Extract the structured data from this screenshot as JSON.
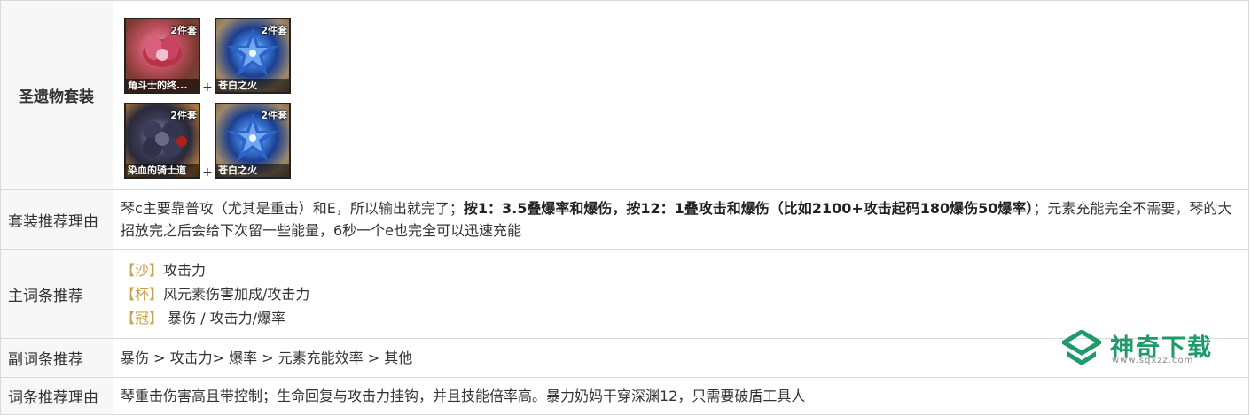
{
  "rows": {
    "set": {
      "label": "圣遗物套装",
      "combos": [
        {
          "items": [
            {
              "badge": "2件套",
              "name": "角斗士的终...",
              "icon": "crimson-flower-icon"
            },
            {
              "badge": "2件套",
              "name": "苍白之火",
              "icon": "blue-flower-icon"
            }
          ],
          "plus": "+"
        },
        {
          "items": [
            {
              "badge": "2件套",
              "name": "染血的骑士道",
              "icon": "dark-flower-icon"
            },
            {
              "badge": "2件套",
              "name": "苍白之火",
              "icon": "blue-flower-icon"
            }
          ],
          "plus": "+"
        }
      ]
    },
    "set_reason": {
      "label": "套装推荐理由",
      "text_a": "琴c主要靠普攻（尤其是重击）和E，所以输出就完了；",
      "text_b": "按1：3.5叠爆率和爆伤，按12：1叠攻击和爆伤（比如2100+攻击起码180爆伤50爆率）",
      "text_c": "；元素充能完全不需要，琴的大招放完之后会给下次留一些能量，6秒一个e也完全可以迅速充能"
    },
    "main_stats": {
      "label": "主词条推荐",
      "slots": [
        {
          "tag": "【沙】",
          "value": "攻击力"
        },
        {
          "tag": "【杯】",
          "value": "风元素伤害加成/攻击力"
        },
        {
          "tag": "【冠】",
          "value": " 暴伤 / 攻击力/爆率"
        }
      ]
    },
    "sub_stats": {
      "label": "副词条推荐",
      "text": "暴伤 > 攻击力> 爆率 > 元素充能效率 > 其他"
    },
    "stat_reason": {
      "label": "词条推荐理由",
      "text": "琴重击伤害高且带控制；生命回复与攻击力挂钩，并且技能倍率高。暴力奶妈干穿深渊12，只需要破盾工具人"
    }
  },
  "watermark": {
    "title": "神奇下载",
    "url": "www.sqxzz.com",
    "color": "#1f9a6a"
  }
}
